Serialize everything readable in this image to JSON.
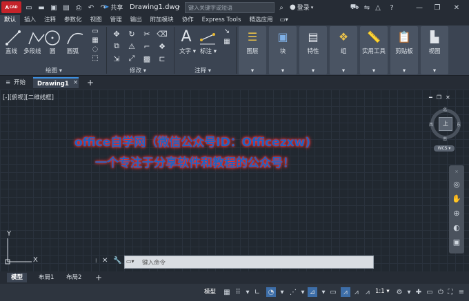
{
  "app": {
    "logo_text": "A",
    "logo_sub": "CAD",
    "document_title": "Drawing1.dwg",
    "share_label": "共享",
    "search_placeholder": "键入关键字或短语",
    "login_label": "登录"
  },
  "ribbon_tabs": [
    "默认",
    "插入",
    "注释",
    "参数化",
    "视图",
    "管理",
    "输出",
    "附加模块",
    "协作",
    "Express Tools",
    "精选应用"
  ],
  "draw_panel": {
    "buttons": [
      "直线",
      "多段线",
      "圆",
      "圆弧"
    ],
    "label": "绘图"
  },
  "modify_panel": {
    "label": "修改"
  },
  "annotation_panel": {
    "buttons": [
      "文字",
      "标注"
    ],
    "label": "注释"
  },
  "big_panels": [
    "图层",
    "块",
    "特性",
    "组",
    "实用工具",
    "剪贴板",
    "视图"
  ],
  "file_tabs": {
    "start": "开始",
    "active": "Drawing1"
  },
  "viewport": {
    "label": "[-][俯视][二维线框]"
  },
  "viewcube": {
    "north": "北",
    "south": "南",
    "east": "东",
    "west": "西",
    "top": "上",
    "wcs": "WCS"
  },
  "watermark": {
    "line1": "office自学网（微信公众号ID：Officezxw)",
    "line2": "一个专注于分享软件和教程的公众号！"
  },
  "ucs": {
    "y": "Y",
    "x": "X"
  },
  "command": {
    "placeholder": "键入命令"
  },
  "layout_tabs": [
    "模型",
    "布局1",
    "布局2"
  ],
  "status": {
    "model": "模型",
    "scale": "1:1"
  }
}
